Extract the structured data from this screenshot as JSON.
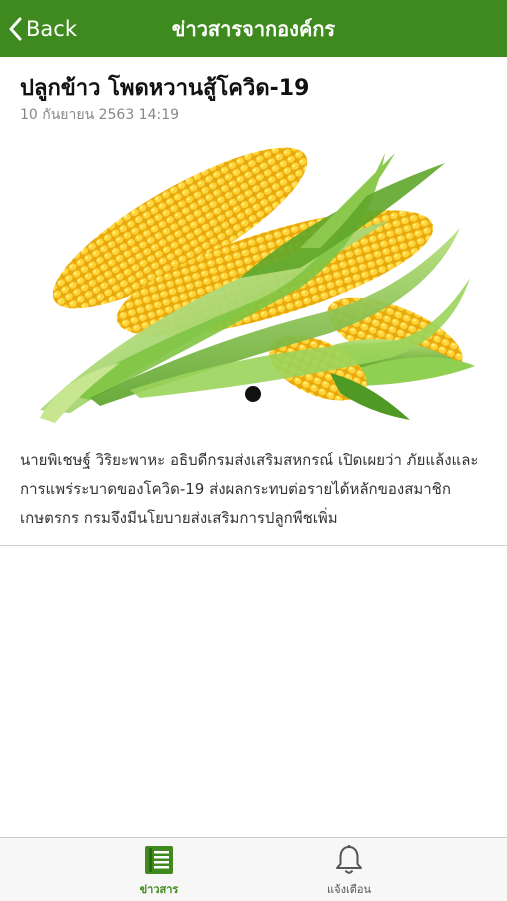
{
  "header": {
    "back_label": "Back",
    "title": "ข่าวสารจากองค์กร"
  },
  "article": {
    "title": "ปลูกข้าว โพดหวานสู้โควิด-19",
    "date": "10 กันยายน 2563 14:19",
    "image_alt": "corn",
    "body": "นายพิเชษฐ์ วิริยะพาหะ อธิบดีกรมส่งเสริมสหกรณ์ เปิดเผยว่า ภัยแล้งและการแพร่ระบาดของโควิด-19 ส่งผลกระทบต่อรายได้หลักของสมาชิกเกษตรกร กรมจึงมีนโยบายส่งเสริมการปลูกพืชเพิ่ม",
    "gallery_pages": 1,
    "gallery_current": 1
  },
  "tabbar": {
    "tabs": [
      {
        "label": "ข่าวสาร",
        "icon": "news-icon",
        "active": true
      },
      {
        "label": "แจ้งเตือน",
        "icon": "bell-icon",
        "active": false
      }
    ]
  },
  "colors": {
    "brand_green": "#3f8a1e",
    "active_tab": "#3f8a1e"
  }
}
